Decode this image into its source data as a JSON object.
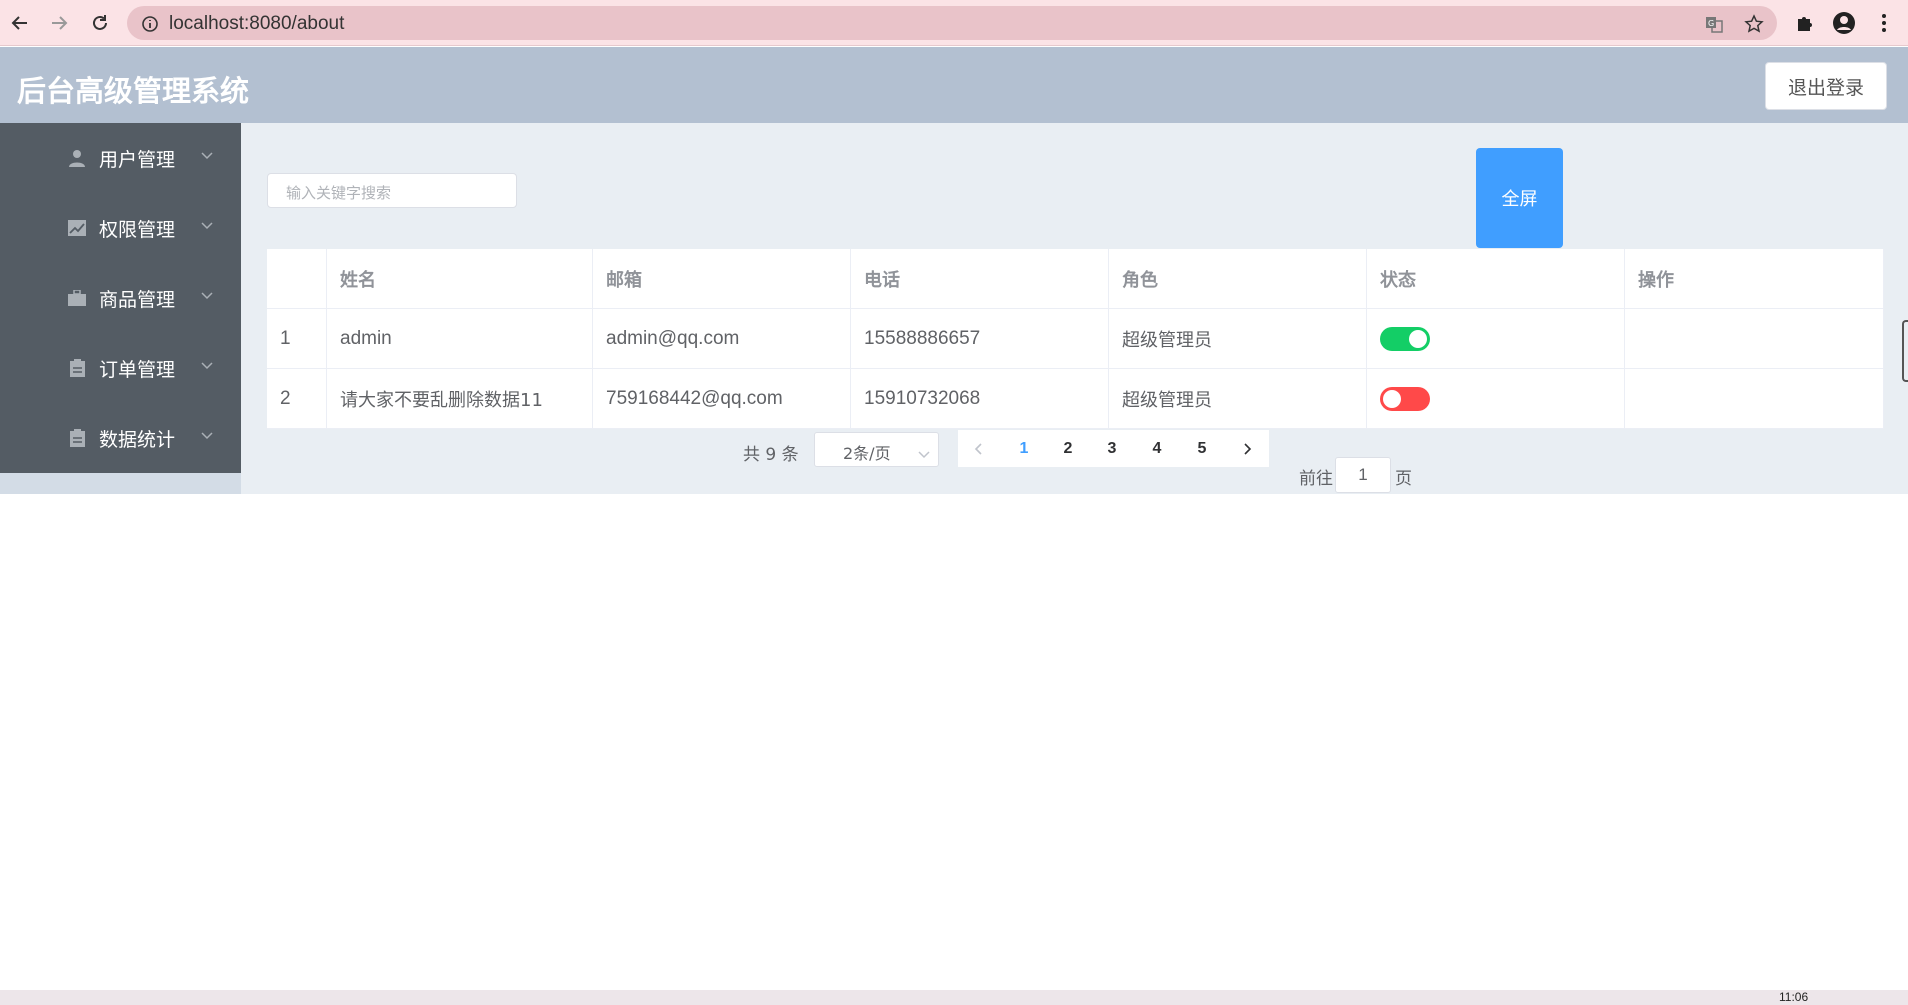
{
  "browser": {
    "url": "localhost:8080/about"
  },
  "header": {
    "title": "后台高级管理系统",
    "logout_label": "退出登录",
    "bg_color": "#b3c0d1"
  },
  "sidebar": {
    "bg_color": "#545c64",
    "items": [
      {
        "label": "用户管理",
        "icon": "user-icon"
      },
      {
        "label": "权限管理",
        "icon": "chart-icon"
      },
      {
        "label": "商品管理",
        "icon": "briefcase-icon"
      },
      {
        "label": "订单管理",
        "icon": "clipboard-icon"
      },
      {
        "label": "数据统计",
        "icon": "clipboard-icon"
      }
    ]
  },
  "main": {
    "search_placeholder": "输入关键字搜索",
    "fullscreen_label": "全屏",
    "accent_color": "#409eff",
    "table": {
      "headers": [
        "",
        "姓名",
        "邮箱",
        "电话",
        "角色",
        "状态",
        "操作"
      ],
      "rows": [
        {
          "index": "1",
          "name": "admin",
          "email": "admin@qq.com",
          "phone": "15588886657",
          "role": "超级管理员",
          "status_on": true
        },
        {
          "index": "2",
          "name": "请大家不要乱删除数据11",
          "email": "759168442@qq.com",
          "phone": "15910732068",
          "role": "超级管理员",
          "status_on": false
        }
      ],
      "switch_on_color": "#13ce66",
      "switch_off_color": "#ff4949"
    },
    "pagination": {
      "total_label": "共 9 条",
      "page_size_label": "2条/页",
      "pages": [
        "1",
        "2",
        "3",
        "4",
        "5"
      ],
      "current_page": "1",
      "goto_prefix": "前往",
      "goto_value": "1",
      "goto_suffix": "页"
    }
  },
  "taskbar": {
    "clock": "11:06"
  }
}
